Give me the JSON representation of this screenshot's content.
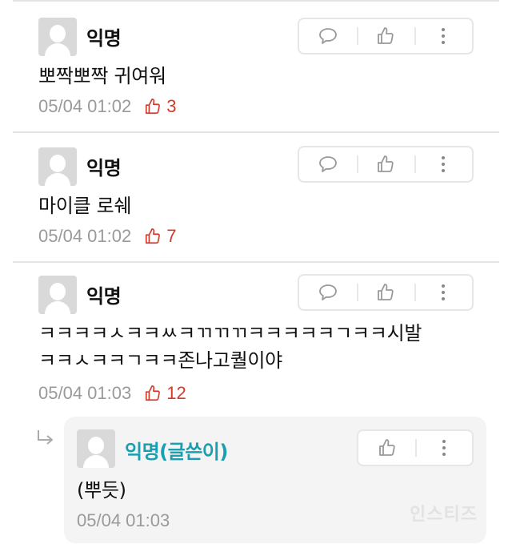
{
  "comments": [
    {
      "author": "익명",
      "text": "뽀짝뽀짝 귀여워",
      "time": "05/04 01:02",
      "likes": "3"
    },
    {
      "author": "익명",
      "text": "마이클 로쉐",
      "time": "05/04 01:02",
      "likes": "7"
    },
    {
      "author": "익명",
      "text_line1": "ㅋㅋㅋㅋㅅㅋㅋㅆㅋㄲㄲㄲㅋㅋㅋㅋㅋㄱㅋㅋ시발",
      "text_line2": "ㅋㅋㅅㅋㅋㄱㅋㅋ존나고퀄이야",
      "time": "05/04 01:03",
      "likes": "12"
    }
  ],
  "reply": {
    "author": "익명(글쓴이)",
    "text": "(뿌듯)",
    "time": "05/04 01:03"
  },
  "watermark": "인스티즈",
  "icons": {
    "reply": "speech-bubble-icon",
    "like": "thumbs-up-icon",
    "more": "vertical-dots-icon",
    "reply_arrow": "reply-arrow-icon"
  },
  "colors": {
    "like": "#d33a2c",
    "op_author": "#1a9fb0",
    "meta": "#9a9a9a"
  }
}
